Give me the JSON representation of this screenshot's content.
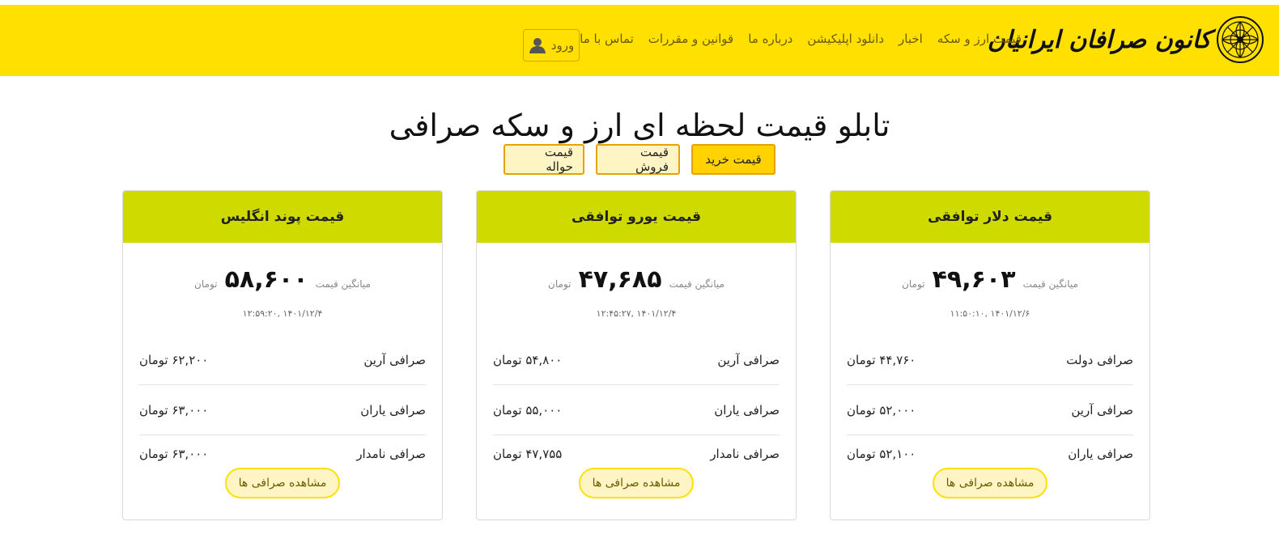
{
  "brand": {
    "name": "کانون صرافان ایرانیان"
  },
  "nav": {
    "items": [
      "قیمت ارز و سکه",
      "اخبار",
      "دانلود اپلیکیشن",
      "درباره ما",
      "قوانین و مقررات",
      "تماس با ما"
    ],
    "login_label": "ورود"
  },
  "page": {
    "title": "تابلو قیمت لحظه ای ارز و سکه صرافی"
  },
  "tabs": {
    "buy": "قیمت خرید",
    "sell": "قیمت فروش",
    "transfer": "قیمت حواله",
    "active": "buy"
  },
  "cards": [
    {
      "title": "قیمت دلار توافقی",
      "avg_label": "میانگین قیمت",
      "avg_value": "۴۹,۶۰۳",
      "avg_unit": "تومان",
      "time": "۱۴۰۱/۱۲/۶ ,۱۱:۵۰:۱۰",
      "rows": [
        {
          "name": "صرافی دولت",
          "price": "۴۴,۷۶۰ تومان"
        },
        {
          "name": "صرافی آرین",
          "price": "۵۲,۰۰۰ تومان"
        },
        {
          "name": "صرافی یاران",
          "price": "۵۲,۱۰۰ تومان"
        }
      ],
      "more_label": "مشاهده صرافی ها"
    },
    {
      "title": "قیمت یورو توافقی",
      "avg_label": "میانگین قیمت",
      "avg_value": "۴۷,۶۸۵",
      "avg_unit": "تومان",
      "time": "۱۴۰۱/۱۲/۴ ,۱۲:۴۵:۲۷",
      "rows": [
        {
          "name": "صرافی آرین",
          "price": "۵۴,۸۰۰ تومان"
        },
        {
          "name": "صرافی یاران",
          "price": "۵۵,۰۰۰ تومان"
        },
        {
          "name": "صرافی نامدار",
          "price": "۴۷,۷۵۵ تومان"
        }
      ],
      "more_label": "مشاهده صرافی ها"
    },
    {
      "title": "قیمت پوند انگلیس",
      "avg_label": "میانگین قیمت",
      "avg_value": "۵۸,۶۰۰",
      "avg_unit": "تومان",
      "time": "۱۴۰۱/۱۲/۴ ,۱۲:۵۹:۲۰",
      "rows": [
        {
          "name": "صرافی آرین",
          "price": "۶۲,۲۰۰ تومان"
        },
        {
          "name": "صرافی یاران",
          "price": "۶۳,۰۰۰ تومان"
        },
        {
          "name": "صرافی نامدار",
          "price": "۶۳,۰۰۰ تومان"
        }
      ],
      "more_label": "مشاهده صرافی ها"
    }
  ],
  "colors": {
    "navbar": "#ffe000",
    "card_header": "#cfdb00",
    "tab_border": "#e6a200"
  }
}
